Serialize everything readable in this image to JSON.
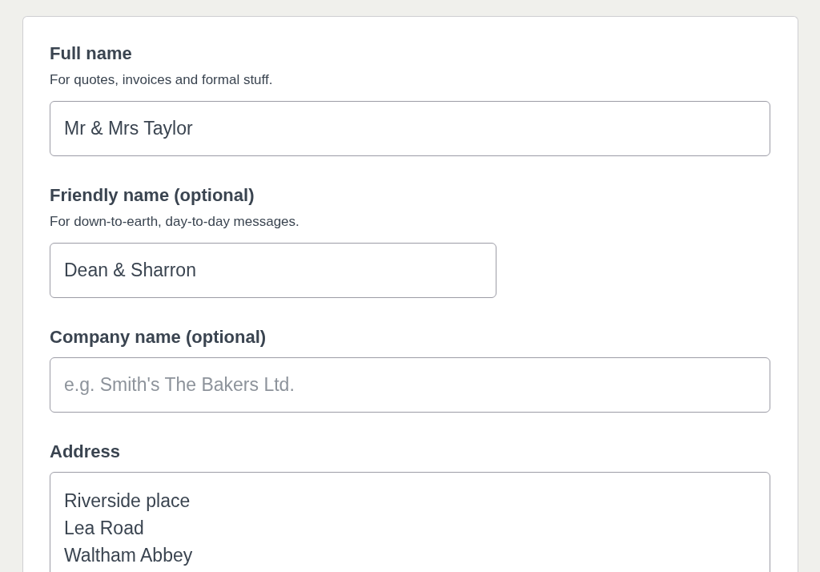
{
  "fields": [
    {
      "kind": "input",
      "label": "Full name",
      "hint": "For quotes, invoices and formal stuff.",
      "value": "Mr & Mrs Taylor"
    },
    {
      "kind": "narrow",
      "label": "Friendly name (optional)",
      "hint": "For down-to-earth, day-to-day messages.",
      "value": "Dean & Sharron"
    },
    {
      "kind": "input",
      "label": "Company name (optional)",
      "placeholder": "e.g. Smith's The Bakers Ltd."
    },
    {
      "kind": "textarea",
      "label": "Address",
      "lines": [
        "Riverside place",
        "Lea Road",
        "Waltham Abbey"
      ]
    }
  ]
}
